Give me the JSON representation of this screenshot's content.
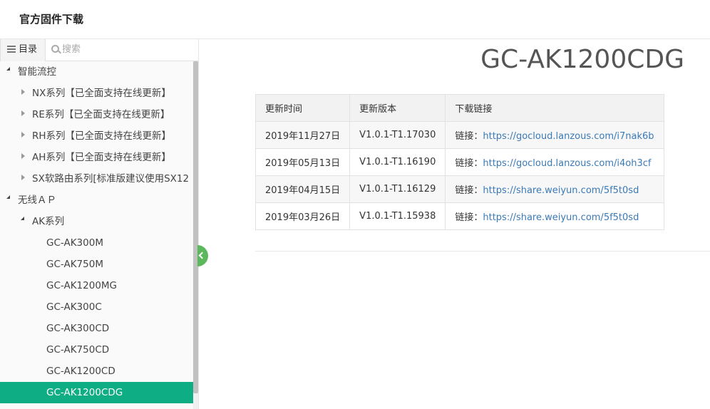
{
  "header": {
    "title": "官方固件下载"
  },
  "sidebar": {
    "toc_label": "目录",
    "search_placeholder": "搜索",
    "items": [
      {
        "label": "智能流控",
        "level": 0,
        "state": "open"
      },
      {
        "label": "NX系列【已全面支持在线更新】",
        "level": 1,
        "state": "closed"
      },
      {
        "label": "RE系列【已全面支持在线更新】",
        "level": 1,
        "state": "closed"
      },
      {
        "label": "RH系列【已全面支持在线更新】",
        "level": 1,
        "state": "closed"
      },
      {
        "label": "AH系列【已全面支持在线更新】",
        "level": 1,
        "state": "closed"
      },
      {
        "label": "SX软路由系列[标准版建议使用SX12",
        "level": 1,
        "state": "closed"
      },
      {
        "label": "无线ＡＰ",
        "level": 0,
        "state": "open"
      },
      {
        "label": "AK系列",
        "level": 1,
        "state": "open"
      },
      {
        "label": "GC-AK300M",
        "level": 2,
        "state": "leaf"
      },
      {
        "label": "GC-AK750M",
        "level": 2,
        "state": "leaf"
      },
      {
        "label": "GC-AK1200MG",
        "level": 2,
        "state": "leaf"
      },
      {
        "label": "GC-AK300C",
        "level": 2,
        "state": "leaf"
      },
      {
        "label": "GC-AK300CD",
        "level": 2,
        "state": "leaf"
      },
      {
        "label": "GC-AK750CD",
        "level": 2,
        "state": "leaf"
      },
      {
        "label": "GC-AK1200CD",
        "level": 2,
        "state": "leaf"
      },
      {
        "label": "GC-AK1200CDG",
        "level": 2,
        "state": "leaf",
        "active": true
      }
    ]
  },
  "main": {
    "title": "GC-AK1200CDG",
    "table": {
      "headers": [
        "更新时间",
        "更新版本",
        "下载链接"
      ],
      "link_prefix": "链接：",
      "rows": [
        {
          "date": "2019年11月27日",
          "version": "V1.0.1-T1.17030",
          "link": "https://gocloud.lanzous.com/i7nak6b"
        },
        {
          "date": "2019年05月13日",
          "version": "V1.0.1-T1.16190",
          "link": "https://gocloud.lanzous.com/i4oh3cf"
        },
        {
          "date": "2019年04月15日",
          "version": "V1.0.1-T1.16129",
          "link": "https://share.weiyun.com/5f5t0sd"
        },
        {
          "date": "2019年03月26日",
          "version": "V1.0.1-T1.15938",
          "link": "https://share.weiyun.com/5f5t0sd"
        }
      ]
    }
  },
  "colors": {
    "active_item": "#0fad84",
    "collapse_button": "#5cb85c",
    "link": "#3a7ab8"
  }
}
